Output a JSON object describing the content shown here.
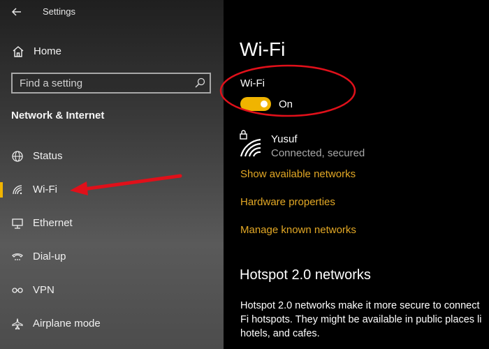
{
  "window": {
    "title": "Settings"
  },
  "sidebar": {
    "home_label": "Home",
    "search": {
      "placeholder": "Find a setting"
    },
    "section_title": "Network & Internet",
    "items": [
      {
        "label": "Status",
        "icon": "globe-icon"
      },
      {
        "label": "Wi-Fi",
        "icon": "wifi-icon",
        "active": true
      },
      {
        "label": "Ethernet",
        "icon": "ethernet-icon"
      },
      {
        "label": "Dial-up",
        "icon": "dialup-icon"
      },
      {
        "label": "VPN",
        "icon": "vpn-icon"
      },
      {
        "label": "Airplane mode",
        "icon": "airplane-icon"
      }
    ]
  },
  "main": {
    "title": "Wi-Fi",
    "wifi_toggle": {
      "label": "Wi-Fi",
      "state": "On"
    },
    "network": {
      "name": "Yusuf",
      "status": "Connected, secured"
    },
    "links": {
      "show_available": "Show available networks",
      "hardware": "Hardware properties",
      "manage_known": "Manage known networks"
    },
    "hotspot": {
      "heading": "Hotspot 2.0 networks",
      "lines": [
        "Hotspot 2.0 networks make it more secure to connect",
        "Fi hotspots. They might be available in public places li",
        "hotels, and cafes."
      ]
    }
  },
  "colors": {
    "accent": "#f0b400",
    "link": "#e3a825",
    "annotation": "#e0101a"
  }
}
